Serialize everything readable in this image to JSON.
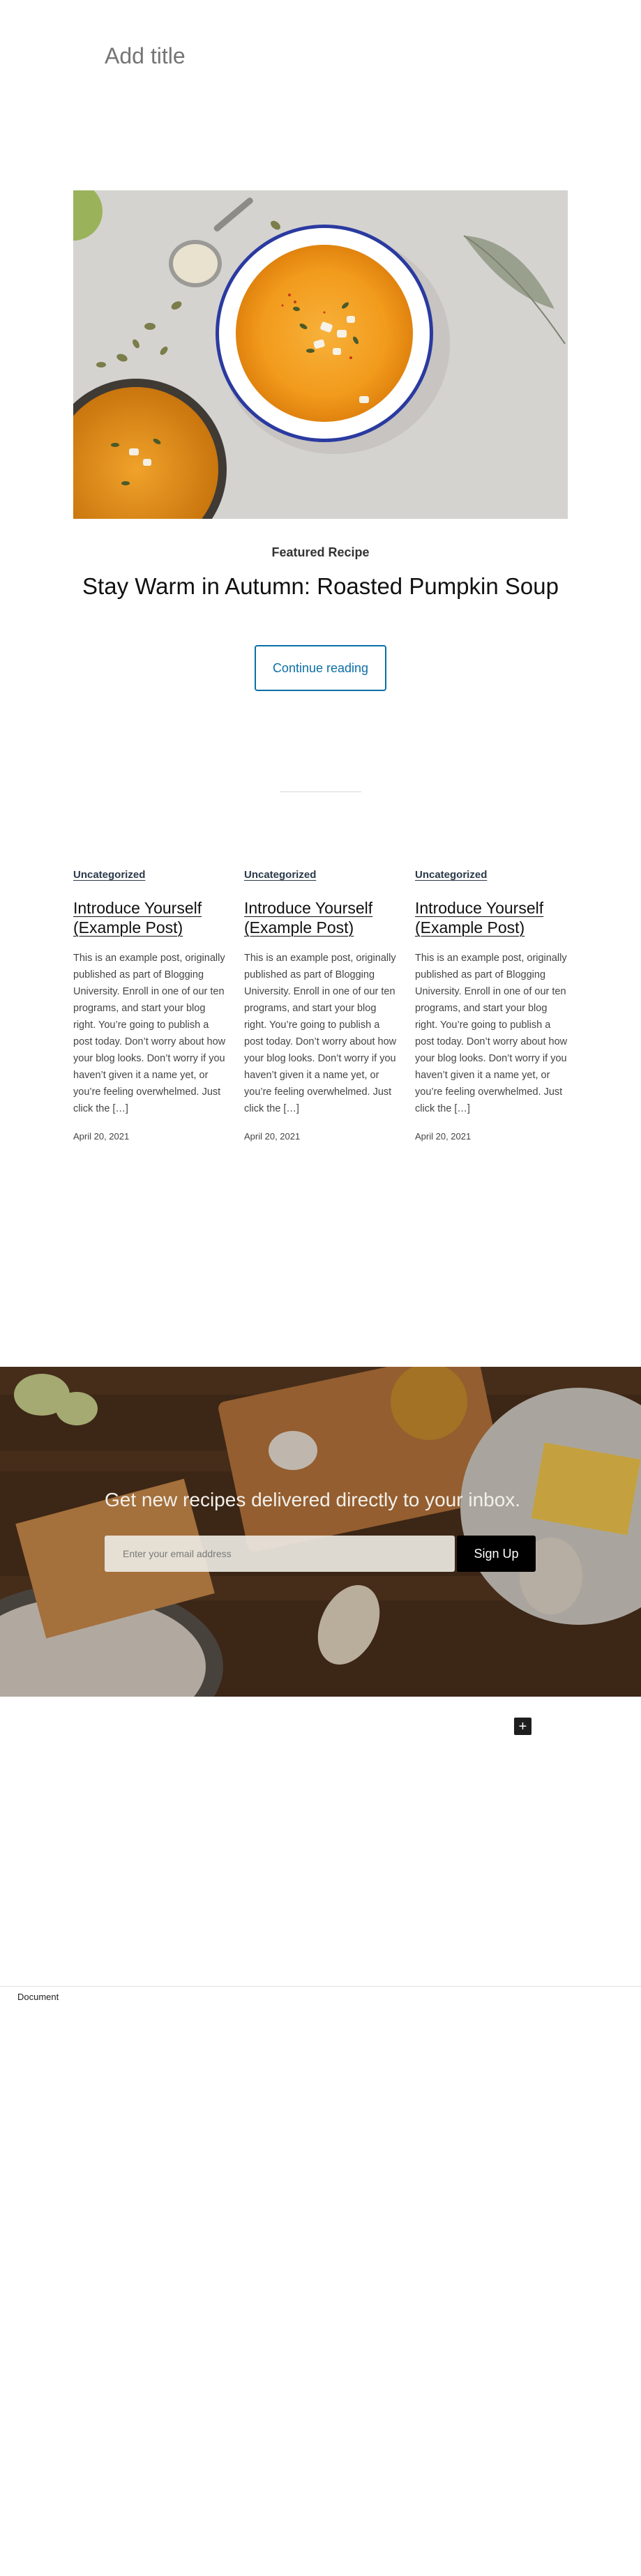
{
  "editor": {
    "title_placeholder": "Add title"
  },
  "featured": {
    "label": "Featured Recipe",
    "title": "Stay Warm in Autumn: Roasted Pumpkin Soup",
    "button_label": "Continue reading"
  },
  "posts": [
    {
      "category": "Uncategorized",
      "title": "Introduce Yourself (Example Post)",
      "excerpt": "This is an example post, originally published as part of Blogging University. Enroll in one of our ten programs, and start your blog right. You’re going to publish a post today. Don’t worry about how your blog looks. Don’t worry if you haven’t given it a name yet, or you’re feeling overwhelmed. Just click the […]",
      "date": "April 20, 2021"
    },
    {
      "category": "Uncategorized",
      "title": "Introduce Yourself (Example Post)",
      "excerpt": "This is an example post, originally published as part of Blogging University. Enroll in one of our ten programs, and start your blog right. You’re going to publish a post today. Don’t worry about how your blog looks. Don’t worry if you haven’t given it a name yet, or you’re feeling overwhelmed. Just click the […]",
      "date": "April 20, 2021"
    },
    {
      "category": "Uncategorized",
      "title": "Introduce Yourself (Example Post)",
      "excerpt": "This is an example post, originally published as part of Blogging University. Enroll in one of our ten programs, and start your blog right. You’re going to publish a post today. Don’t worry about how your blog looks. Don’t worry if you haven’t given it a name yet, or you’re feeling overwhelmed. Just click the […]",
      "date": "April 20, 2021"
    }
  ],
  "newsletter": {
    "heading": "Get new recipes delivered directly to your inbox.",
    "email_placeholder": "Enter your email address",
    "button_label": "Sign Up"
  },
  "toolbar": {
    "add_block_symbol": "+"
  },
  "footer": {
    "breadcrumb": "Document"
  },
  "colors": {
    "link_blue": "#0b6fa6",
    "button_black": "#000000"
  },
  "icons": {
    "add_block": "plus-icon"
  }
}
